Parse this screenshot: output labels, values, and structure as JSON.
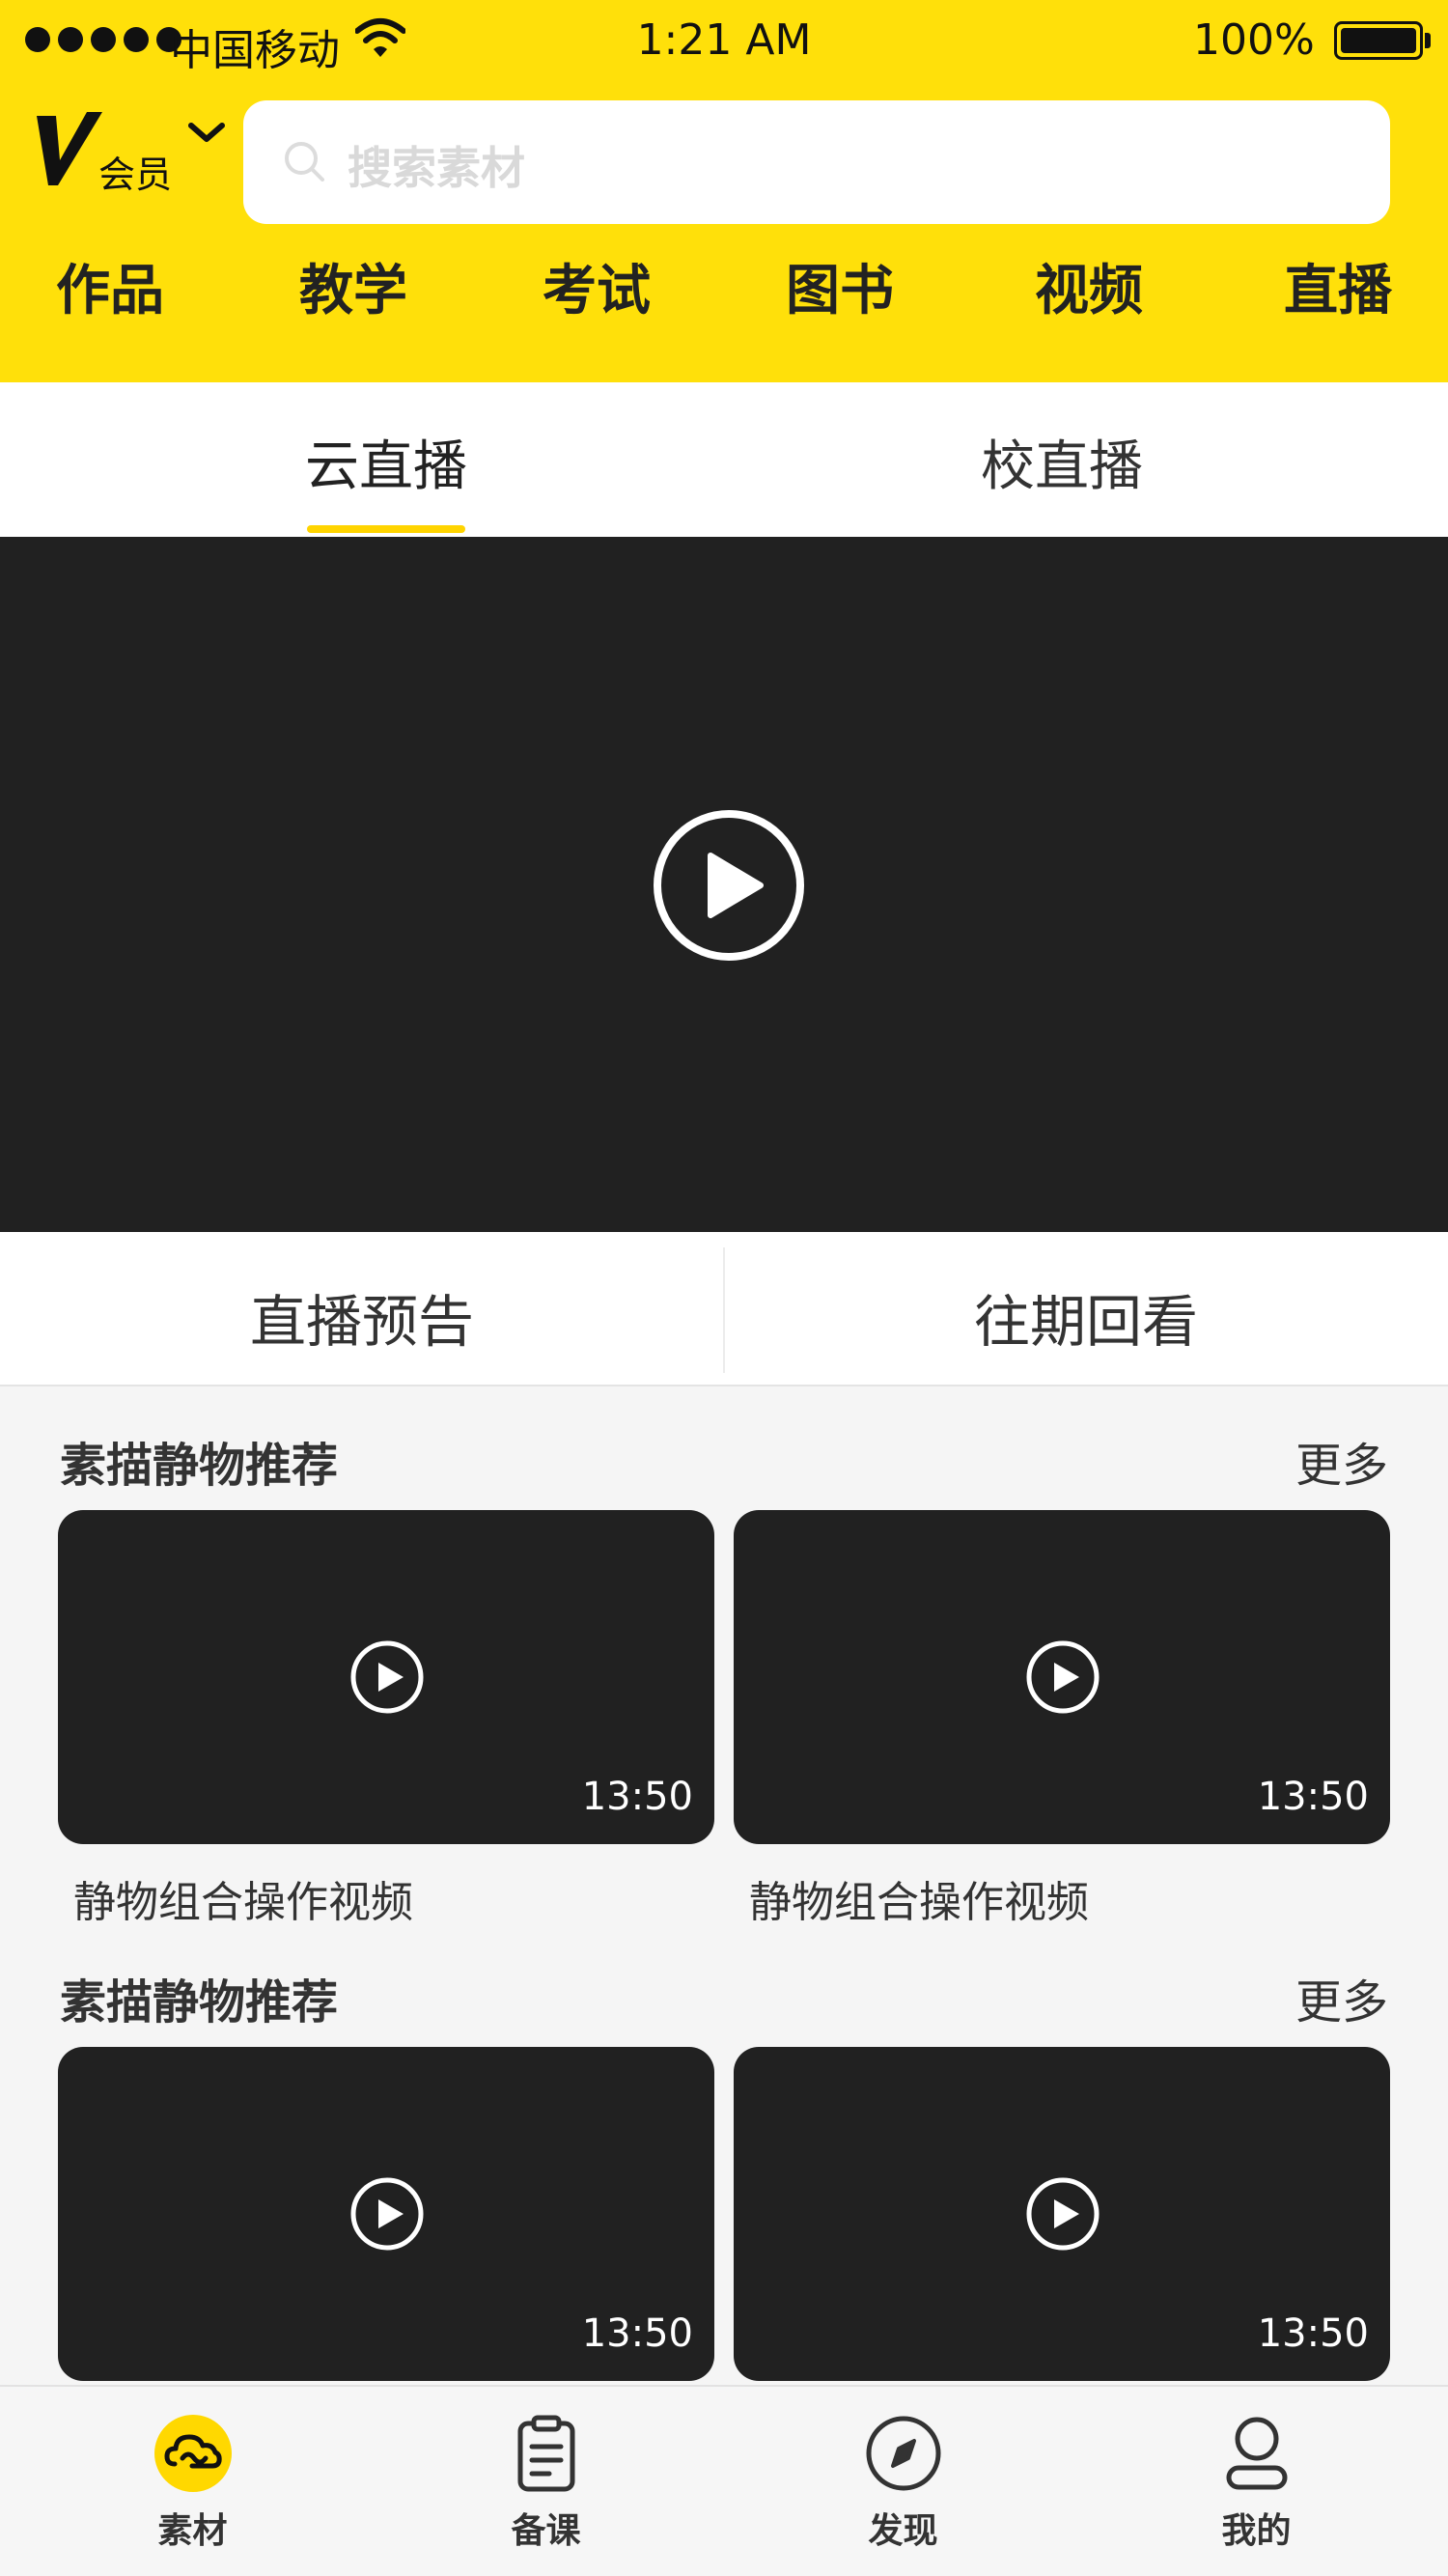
{
  "status_bar": {
    "carrier": "中国移动",
    "time": "1:21 AM",
    "battery": "100%"
  },
  "header": {
    "member_label": "会员",
    "search_placeholder": "搜索素材"
  },
  "top_tabs": [
    "作品",
    "教学",
    "考试",
    "图书",
    "视频",
    "直播"
  ],
  "sub_tabs": {
    "items": [
      "云直播",
      "校直播"
    ],
    "active": "云直播"
  },
  "live_segment": [
    "直播预告",
    "往期回看"
  ],
  "sections": [
    {
      "title": "素描静物推荐",
      "more": "更多",
      "videos": [
        {
          "duration": "13:50",
          "caption": "静物组合操作视频"
        },
        {
          "duration": "13:50",
          "caption": "静物组合操作视频"
        }
      ]
    },
    {
      "title": "素描静物推荐",
      "more": "更多",
      "videos": [
        {
          "duration": "13:50"
        },
        {
          "duration": "13:50"
        }
      ]
    }
  ],
  "tabbar": [
    {
      "label": "素材",
      "icon": "cloud-icon",
      "active": true
    },
    {
      "label": "备课",
      "icon": "clipboard-icon",
      "active": false
    },
    {
      "label": "发现",
      "icon": "compass-icon",
      "active": false
    },
    {
      "label": "我的",
      "icon": "user-icon",
      "active": false
    }
  ],
  "colors": {
    "brand_yellow": "#ffe00a",
    "video_bg": "#212121"
  }
}
